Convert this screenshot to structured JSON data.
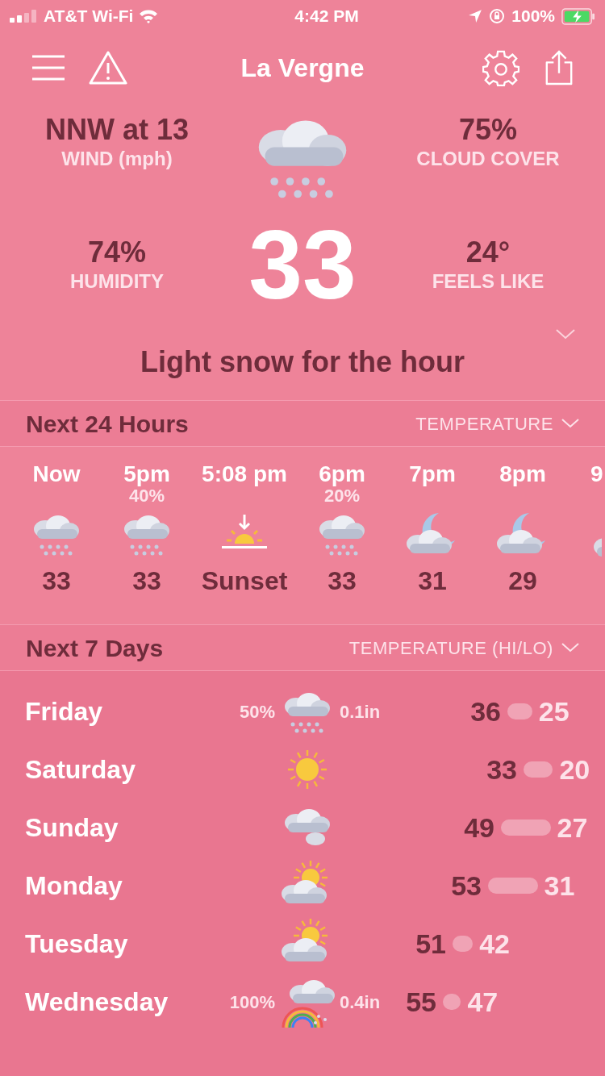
{
  "status_bar": {
    "carrier": "AT&T Wi-Fi",
    "time": "4:42 PM",
    "battery": "100%"
  },
  "header": {
    "title": "La Vergne"
  },
  "current": {
    "wind": {
      "value": "NNW at 13",
      "label": "WIND (mph)"
    },
    "cloud_cover": {
      "value": "75%",
      "label": "CLOUD COVER"
    },
    "humidity": {
      "value": "74%",
      "label": "HUMIDITY"
    },
    "feels_like": {
      "value": "24°",
      "label": "FEELS LIKE"
    },
    "temperature": "33",
    "summary": "Light snow for the hour"
  },
  "hourly": {
    "title": "Next 24 Hours",
    "selector": "TEMPERATURE",
    "items": [
      {
        "kind": "snow",
        "time": "Now",
        "temp": "33"
      },
      {
        "kind": "snow",
        "time": "5pm",
        "chance": "40%",
        "temp": "33"
      },
      {
        "kind": "sunset",
        "time": "5:08 pm",
        "temp": "Sunset"
      },
      {
        "kind": "snow",
        "time": "6pm",
        "chance": "20%",
        "temp": "33"
      },
      {
        "kind": "night",
        "time": "7pm",
        "temp": "31"
      },
      {
        "kind": "night",
        "time": "8pm",
        "temp": "29"
      },
      {
        "kind": "night",
        "time": "9"
      }
    ]
  },
  "daily": {
    "title": "Next 7 Days",
    "selector": "TEMPERATURE (HI/LO)",
    "items": [
      {
        "kind": "snow",
        "day": "Friday",
        "chance": "50%",
        "amount": "0.1in",
        "high": "36",
        "low": "25"
      },
      {
        "kind": "sunny",
        "day": "Saturday",
        "high": "33",
        "low": "20"
      },
      {
        "kind": "cloudy",
        "day": "Sunday",
        "high": "49",
        "low": "27"
      },
      {
        "kind": "partly",
        "day": "Monday",
        "high": "53",
        "low": "31"
      },
      {
        "kind": "partly",
        "day": "Tuesday",
        "high": "51",
        "low": "42"
      },
      {
        "kind": "rain",
        "day": "Wednesday",
        "chance": "100%",
        "amount": "0.4in",
        "high": "55",
        "low": "47"
      }
    ]
  }
}
